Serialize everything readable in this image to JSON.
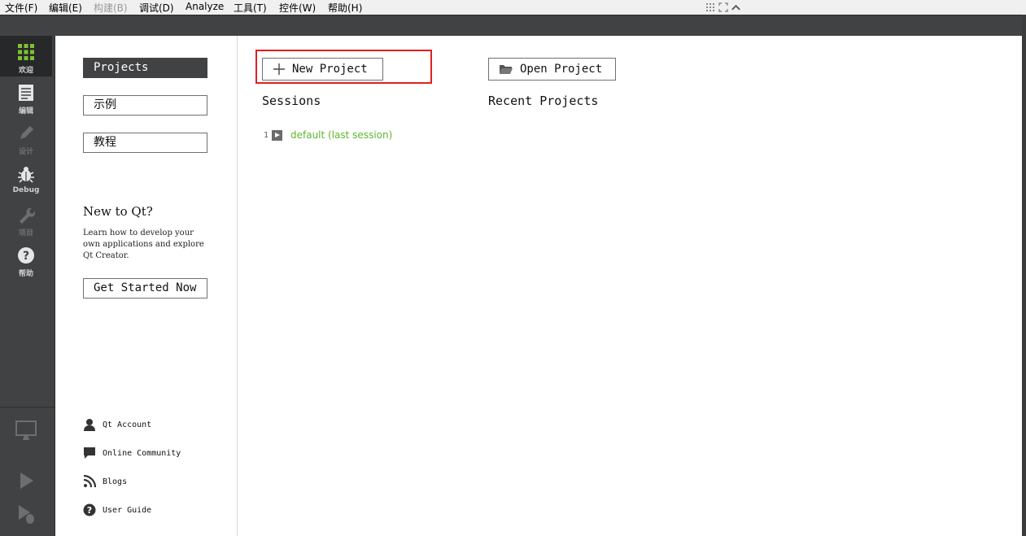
{
  "menu": {
    "items": [
      {
        "label": "文件(F)",
        "enabled": true
      },
      {
        "label": "编辑(E)",
        "enabled": true
      },
      {
        "label": "构建(B)",
        "enabled": false
      },
      {
        "label": "调试(D)",
        "enabled": true
      },
      {
        "label": "Analyze",
        "enabled": true
      },
      {
        "label": "工具(T)",
        "enabled": true
      },
      {
        "label": "控件(W)",
        "enabled": true
      },
      {
        "label": "帮助(H)",
        "enabled": true
      }
    ],
    "window_icons": [
      "grip-icon",
      "expand-icon",
      "collapse-icon"
    ]
  },
  "modes": [
    {
      "label": "欢迎",
      "icon": "grid-icon",
      "active": true
    },
    {
      "label": "编辑",
      "icon": "document-icon"
    },
    {
      "label": "设计",
      "icon": "pencil-icon",
      "disabled": true
    },
    {
      "label": "Debug",
      "icon": "bug-icon"
    },
    {
      "label": "项目",
      "icon": "wrench-icon",
      "disabled": true
    },
    {
      "label": "帮助",
      "icon": "help-icon"
    }
  ],
  "welcome": {
    "tabs": [
      "Projects",
      "示例",
      "教程"
    ],
    "new_to_qt": {
      "title": "New to Qt?",
      "text": "Learn how to develop your own applications and explore Qt Creator.",
      "button": "Get Started Now"
    },
    "links": [
      {
        "label": "Qt Account",
        "icon": "user-icon"
      },
      {
        "label": "Online Community",
        "icon": "chat-icon"
      },
      {
        "label": "Blogs",
        "icon": "rss-icon"
      },
      {
        "label": "User Guide",
        "icon": "help-icon"
      }
    ]
  },
  "projects": {
    "new_project": "New Project",
    "open_project": "Open Project",
    "sessions_title": "Sessions",
    "recent_title": "Recent Projects",
    "sessions": [
      {
        "number": "1",
        "name": "default (last session)"
      }
    ]
  },
  "colors": {
    "sidebar_bg": "#404244",
    "active_mode_bg": "#272829",
    "session_link": "#5cb82e",
    "highlight_border": "#e02020"
  }
}
